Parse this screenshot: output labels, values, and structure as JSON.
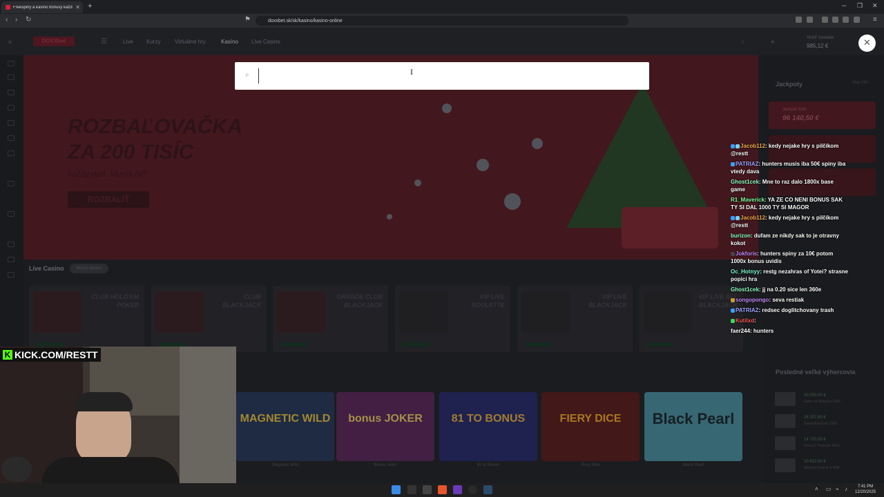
{
  "browser": {
    "tab_title": "Freespiny a kasino bonusy každý deň",
    "url": "doxxbet.sk/sk/kasino/kasino-online"
  },
  "site": {
    "logo": "DOXXbet",
    "nav": [
      "Live",
      "Kurzy",
      "Virtuálne hry",
      "Kasíno",
      "Live Casino"
    ],
    "balance_label": "Vložiť zostatok",
    "balance": "985,12 €",
    "banner": {
      "title": "ROZBAĽOVAČKA\nZA 200 TISÍC",
      "subtitle": "každý deň. Musíš ísť!",
      "button": "ROZBALIŤ"
    },
    "live_casino": {
      "label": "Live Casino",
      "tag": "Bonus kasíno",
      "cards": [
        "CLUB HOLD'EM\nPOKER",
        "CLUB\nBLACKJACK",
        "GRANDE CLUB\nBLACKJACK",
        "VIP LIVE\nROULETTE",
        "VIP LIVE\nBLACKJACK",
        "VIP LIVE ALL\nBLACKJACK"
      ]
    },
    "slots": [
      {
        "name": "MAGNETIC WILD",
        "caption": "Magnetic Wild"
      },
      {
        "name": "bonus JOKER",
        "caption": "Bonus Joker"
      },
      {
        "name": "81 TO BONUS",
        "caption": "81 to Bonus"
      },
      {
        "name": "FIERY DICE",
        "caption": "Fiery Dice"
      },
      {
        "name": "Black Pearl",
        "caption": "Black Pearl"
      }
    ],
    "jackpots": {
      "label": "Jackpoty",
      "link": "Viac info",
      "card_name": "Jackpot Sofo",
      "card_value": "96 140,50 €"
    },
    "winners": {
      "label": "Posledné veľké výhercovia",
      "rows": [
        {
          "value": "20 000,00 €",
          "game": "Gates of Olympus 1000"
        },
        {
          "value": "24 257,80 €",
          "game": "Sweet Bonanza 1000"
        },
        {
          "value": "14 720,00 €",
          "game": "Gonzo's Treasure Hunt"
        },
        {
          "value": "10 622,50 €",
          "game": "Wanted Dead or a Wild"
        }
      ]
    }
  },
  "search": {
    "placeholder": "",
    "close_label": "✕"
  },
  "stream": {
    "channel": "KICK.COM/RESTT",
    "chat": [
      {
        "user": "Jacob112",
        "color": "#f5b04a",
        "text": "kedy nejake hry s pilčíkom @restt",
        "badges": [
          "#3aa0ff",
          "#7ad0ff"
        ]
      },
      {
        "user": "PATRIAZ",
        "color": "#9fa4ff",
        "text": "hunters musis iba 50€ spiny iba vtedy dava",
        "badges": [
          "#3aa0ff"
        ]
      },
      {
        "user": "Ghost1cek",
        "color": "#8effc1",
        "text": "Mne to raz dalo 1800x base game",
        "badges": []
      },
      {
        "user": "R1_Maverick",
        "color": "#7dff9a",
        "text": "YA ZE CO NENI BONUS SAK TY SI DAL 1000 TY SI MAGOR",
        "badges": []
      },
      {
        "user": "Jacob112",
        "color": "#f5b04a",
        "text": "kedy nejake hry s pilčíkom @restt",
        "badges": [
          "#3aa0ff",
          "#7ad0ff"
        ]
      },
      {
        "user": "burizon",
        "color": "#8effc1",
        "text": "dufam ze nikdy sak to je otravny kokot",
        "badges": []
      },
      {
        "user": "Jokforis",
        "color": "#c58cff",
        "text": "hunters spiny za 10€ potom 1000x bonus uvidis",
        "badges": [
          "#444"
        ]
      },
      {
        "user": "Oc_Hotnyy",
        "color": "#7dffd0",
        "text": "restg nezahras of Yotei? strasne popici hra",
        "badges": []
      },
      {
        "user": "Ghost1cek",
        "color": "#8effc1",
        "text": "jj na 0.20 sice len 360e",
        "badges": []
      },
      {
        "user": "songopongo",
        "color": "#c58cff",
        "text": "seva restiak",
        "badges": [
          "#c8a030"
        ]
      },
      {
        "user": "PATRIAZ",
        "color": "#9fa4ff",
        "text": "redsec doglitchovany trash",
        "badges": [
          "#3aa0ff"
        ]
      },
      {
        "user": "Kutilxd",
        "color": "#ff5a5a",
        "text": "",
        "badges": [
          "#3adc5a"
        ]
      },
      {
        "user": "faer244",
        "color": "#ffffff",
        "text": "hunters",
        "badges": []
      }
    ]
  },
  "taskbar": {
    "time": "7:41 PM",
    "date": "12/20/2025"
  }
}
